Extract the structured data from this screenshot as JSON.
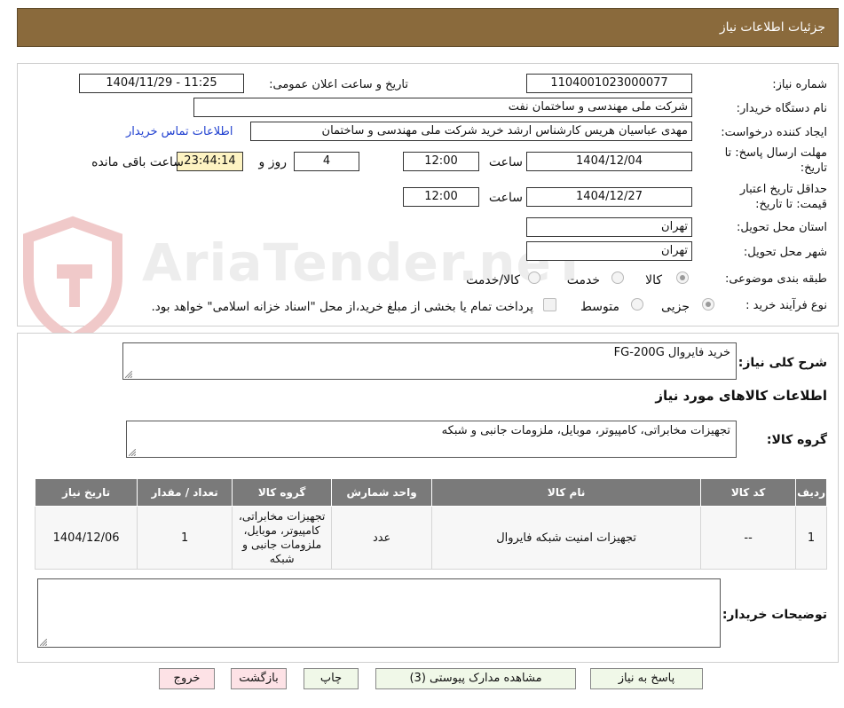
{
  "header": {
    "title": "جزئیات اطلاعات نیاز"
  },
  "need_number": {
    "label": "شماره نیاز:",
    "value": "1104001023000077"
  },
  "announce": {
    "label": "تاریخ و ساعت اعلان عمومی:",
    "value": "1404/11/29 - 11:25"
  },
  "buyer_org": {
    "label": "نام دستگاه خریدار:",
    "value": "شرکت ملی مهندسی و ساختمان نفت"
  },
  "creator": {
    "label": "ایجاد کننده درخواست:",
    "value": "مهدی عباسیان هریس کارشناس ارشد خرید شرکت ملی مهندسی و ساختمان",
    "contact_link": "اطلاعات تماس خریدار"
  },
  "deadline": {
    "label_line1": "مهلت ارسال پاسخ: تا",
    "label_line2": "تاریخ:",
    "date": "1404/12/04",
    "time_label": "ساعت",
    "time": "12:00",
    "days": "4",
    "days_label": "روز و",
    "remaining": "23:44:14",
    "remaining_label": "ساعت باقی مانده"
  },
  "validity": {
    "label_line1": "حداقل تاریخ اعتبار",
    "label_line2": "قیمت: تا تاریخ:",
    "date": "1404/12/27",
    "time_label": "ساعت",
    "time": "12:00"
  },
  "province": {
    "label": "استان محل تحویل:",
    "value": "تهران"
  },
  "city": {
    "label": "شهر محل تحویل:",
    "value": "تهران"
  },
  "category": {
    "label": "طبقه بندی موضوعی:",
    "options": [
      "کالا",
      "خدمت",
      "کالا/خدمت"
    ],
    "selected": "کالا"
  },
  "process": {
    "label": "نوع فرآیند خرید :",
    "options": [
      "جزیی",
      "متوسط"
    ],
    "selected": "جزیی",
    "treasury_note": "پرداخت تمام یا بخشی از مبلغ خرید،از محل \"اسناد خزانه اسلامی\" خواهد بود."
  },
  "watermark": {
    "text": "AriaTender.neT"
  },
  "general_desc": {
    "label": "شرح کلی نیاز:",
    "value": "خرید فایروال FG-200G"
  },
  "goods_info": {
    "heading": "اطلاعات کالاهای مورد نیاز"
  },
  "goods_group": {
    "label": "گروه کالا:",
    "value": "تجهیزات مخابراتی، کامپیوتر، موبایل، ملزومات جانبی و شبکه"
  },
  "table": {
    "headers": [
      "ردیف",
      "کد کالا",
      "نام کالا",
      "واحد شمارش",
      "گروه کالا",
      "تعداد / مقدار",
      "تاریخ نیاز"
    ],
    "rows": [
      {
        "row": "1",
        "code": "--",
        "name": "تجهیزات امنیت شبکه فایروال",
        "unit": "عدد",
        "group": "تجهیزات مخابراتی، کامپیوتر، موبایل، ملزومات جانبی و شبکه",
        "qty": "1",
        "date": "1404/12/06"
      }
    ]
  },
  "buyer_notes": {
    "label": "توضیحات خریدار:",
    "value": ""
  },
  "buttons": {
    "reply": "پاسخ به نیاز",
    "attachments": "مشاهده مدارک پیوستی (3)",
    "print": "چاپ",
    "back": "بازگشت",
    "exit": "خروج"
  },
  "colors": {
    "header_bg": "#8a6a3c",
    "table_header_bg": "#7a7a7a",
    "remaining_bg": "#fdf3c2",
    "link": "#1f3fd0",
    "exit_bg": "#fde2e6",
    "button_bg": "#f0f8e8"
  }
}
